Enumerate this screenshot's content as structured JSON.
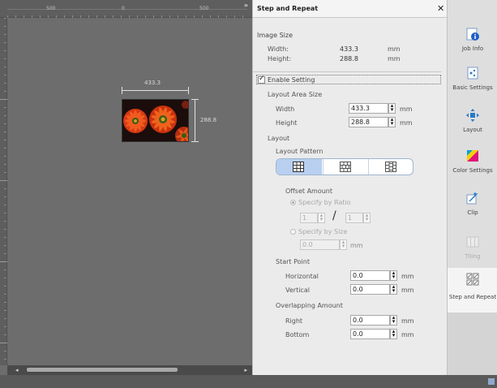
{
  "canvas": {
    "ruler_labels": [
      "500",
      "0",
      "500"
    ],
    "collapse_icon": "double-right-arrow",
    "width_label": "433.3",
    "height_label": "288.8"
  },
  "panel": {
    "title": "Step and Repeat",
    "image_size": {
      "heading": "Image Size",
      "width_label": "Width:",
      "width_value": "433.3",
      "width_unit": "mm",
      "height_label": "Height:",
      "height_value": "288.8",
      "height_unit": "mm"
    },
    "enable_setting": {
      "label": "Enable Setting",
      "checked": true
    },
    "layout_area": {
      "heading": "Layout Area Size",
      "width_label": "Width",
      "width_value": "433.3",
      "width_unit": "mm",
      "height_label": "Height",
      "height_value": "288.8",
      "height_unit": "mm"
    },
    "layout": {
      "heading": "Layout",
      "pattern_label": "Layout Pattern",
      "pattern_options": [
        "grid",
        "brick-horizontal",
        "brick-vertical"
      ],
      "selected_pattern": "grid"
    },
    "offset": {
      "heading": "Offset Amount",
      "ratio_label": "Specify by Ratio",
      "ratio_numerator": "1",
      "ratio_denominator": "1",
      "separator": "/",
      "size_label": "Specify by Size",
      "size_value": "0.0",
      "size_unit": "mm"
    },
    "start_point": {
      "heading": "Start Point",
      "horizontal_label": "Horizontal",
      "horizontal_value": "0.0",
      "horizontal_unit": "mm",
      "vertical_label": "Vertical",
      "vertical_value": "0.0",
      "vertical_unit": "mm"
    },
    "overlap": {
      "heading": "Overlapping Amount",
      "right_label": "Right",
      "right_value": "0.0",
      "right_unit": "mm",
      "bottom_label": "Bottom",
      "bottom_value": "0.0",
      "bottom_unit": "mm"
    }
  },
  "tabs": [
    {
      "label": "Job Info",
      "icon": "info-icon"
    },
    {
      "label": "Basic Settings",
      "icon": "basic-settings-icon"
    },
    {
      "label": "Layout",
      "icon": "layout-move-icon"
    },
    {
      "label": "Color Settings",
      "icon": "color-settings-icon"
    },
    {
      "label": "Clip",
      "icon": "clip-icon"
    },
    {
      "label": "Tiling",
      "icon": "tiling-icon"
    },
    {
      "label": "Step and Repeat",
      "icon": "step-repeat-icon"
    }
  ]
}
